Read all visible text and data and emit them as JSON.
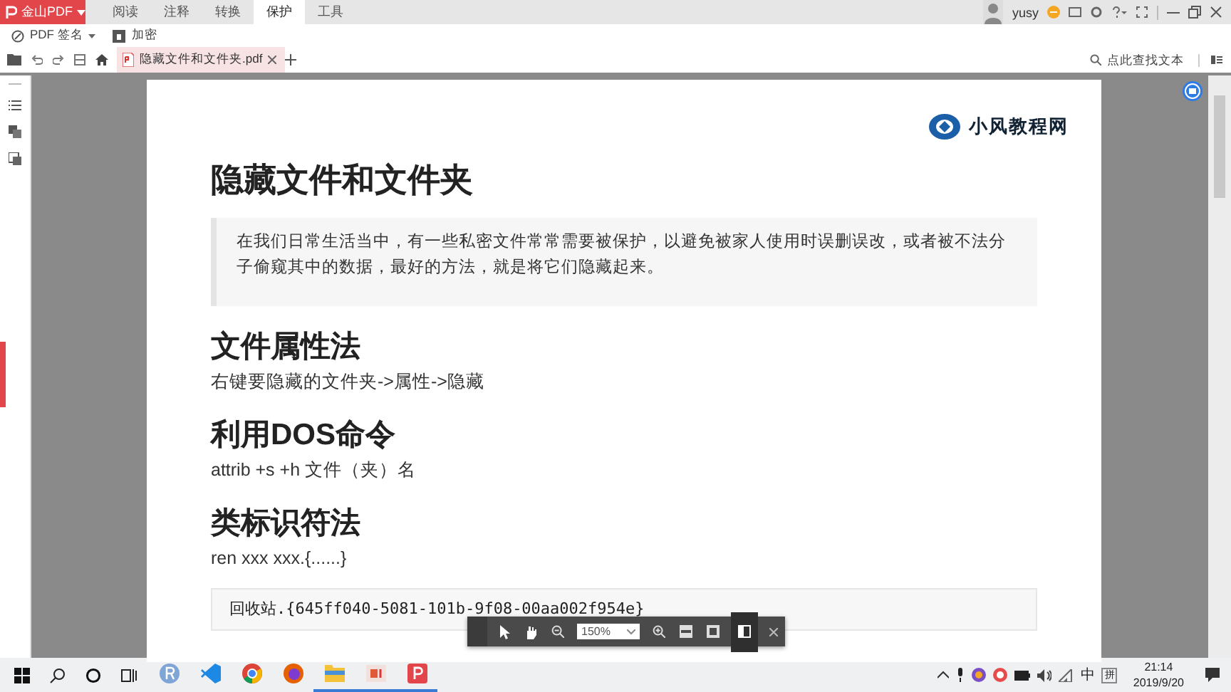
{
  "app": {
    "brand": "金山PDF",
    "menu_tabs": [
      {
        "label": "阅读",
        "selected": false
      },
      {
        "label": "注释",
        "selected": false
      },
      {
        "label": "转换",
        "selected": false
      },
      {
        "label": "保护",
        "selected": true
      },
      {
        "label": "工具",
        "selected": false
      }
    ],
    "user": "yusy"
  },
  "toolbar": [
    {
      "kind": "sign",
      "label": "PDF 签名",
      "dropdown": true
    },
    {
      "kind": "encrypt",
      "label": "加密",
      "dropdown": false
    }
  ],
  "doc_tabs": [
    {
      "label": "隐藏文件和文件夹.pdf",
      "selected": true
    }
  ],
  "search": {
    "placeholder": "点此查找文本"
  },
  "document": {
    "logo": "小风教程网",
    "blocks": [
      {
        "kind": "heading1",
        "text": "隐藏文件和文件夹"
      },
      {
        "kind": "quote",
        "text": "在我们日常生活当中，有一些私密文件常常需要被保护，以避免被家人使用时误删误改，或者被不法分子偷窥其中的数据，最好的方法，就是将它们隐藏起来。"
      },
      {
        "kind": "heading2",
        "text": "文件属性法"
      },
      {
        "kind": "paragraph",
        "text": "右键要隐藏的文件夹->属性->隐藏"
      },
      {
        "kind": "heading2",
        "text": "利用DOS命令"
      },
      {
        "kind": "paragraph",
        "text": "attrib +s +h 文件（夹）名"
      },
      {
        "kind": "heading2",
        "text": "类标识符法"
      },
      {
        "kind": "paragraph",
        "text": "ren xxx xxx.{......}"
      },
      {
        "kind": "code",
        "text": "回收站.{645ff040-5081-101b-9f08-00aa002f954e}"
      }
    ]
  },
  "view_toolbar": {
    "zoom": "150%"
  },
  "taskbar": {
    "apps": [
      {
        "kind": "r",
        "running": false
      },
      {
        "kind": "vscode",
        "running": false
      },
      {
        "kind": "chrome",
        "running": false
      },
      {
        "kind": "firefox",
        "running": false
      },
      {
        "kind": "explorer",
        "running": true
      },
      {
        "kind": "slides",
        "running": true
      },
      {
        "kind": "pdf",
        "running": true
      }
    ],
    "ime": "中",
    "ime_mode": "拼",
    "time": "21:14",
    "date": "2019/9/20"
  }
}
